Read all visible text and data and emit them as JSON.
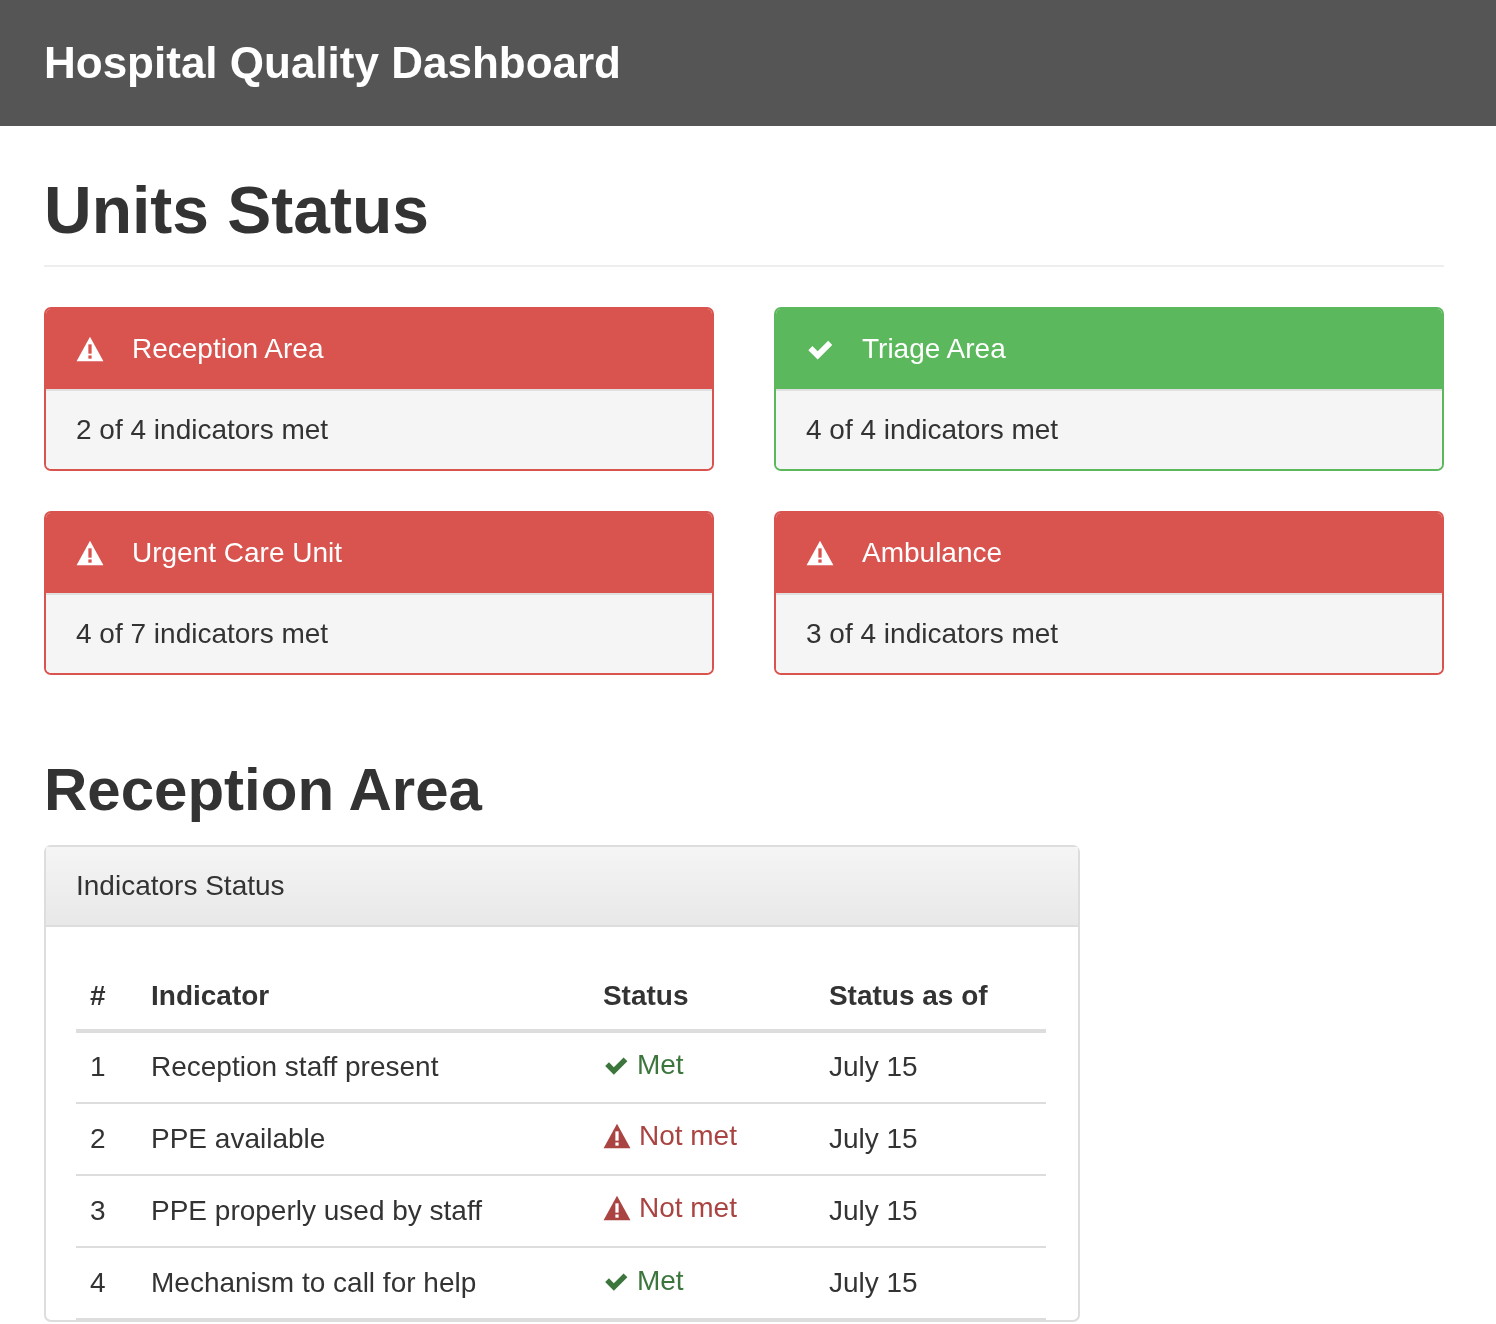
{
  "navbar": {
    "title": "Hospital Quality Dashboard"
  },
  "units_heading": "Units Status",
  "units": [
    {
      "name": "Reception Area",
      "all_met": false,
      "summary": "2 of 4 indicators met"
    },
    {
      "name": "Triage Area",
      "all_met": true,
      "summary": "4 of 4 indicators met"
    },
    {
      "name": "Urgent Care Unit",
      "all_met": false,
      "summary": "4 of 7 indicators met"
    },
    {
      "name": "Ambulance",
      "all_met": false,
      "summary": "3 of 4 indicators met"
    }
  ],
  "detail_heading": "Reception Area",
  "panel": {
    "title": "Indicators Status",
    "table": {
      "columns": [
        "#",
        "Indicator",
        "Status",
        "Status as of"
      ],
      "rows": [
        {
          "number": "1",
          "indicator": "Reception staff present",
          "status": "Met",
          "met": true,
          "date": "July 15"
        },
        {
          "number": "2",
          "indicator": "PPE available",
          "status": "Not met",
          "met": false,
          "date": "July 15"
        },
        {
          "number": "3",
          "indicator": "PPE properly used by staff",
          "status": "Not met",
          "met": false,
          "date": "July 15"
        },
        {
          "number": "4",
          "indicator": "Mechanism to call for help",
          "status": "Met",
          "met": true,
          "date": "July 15"
        }
      ]
    }
  }
}
